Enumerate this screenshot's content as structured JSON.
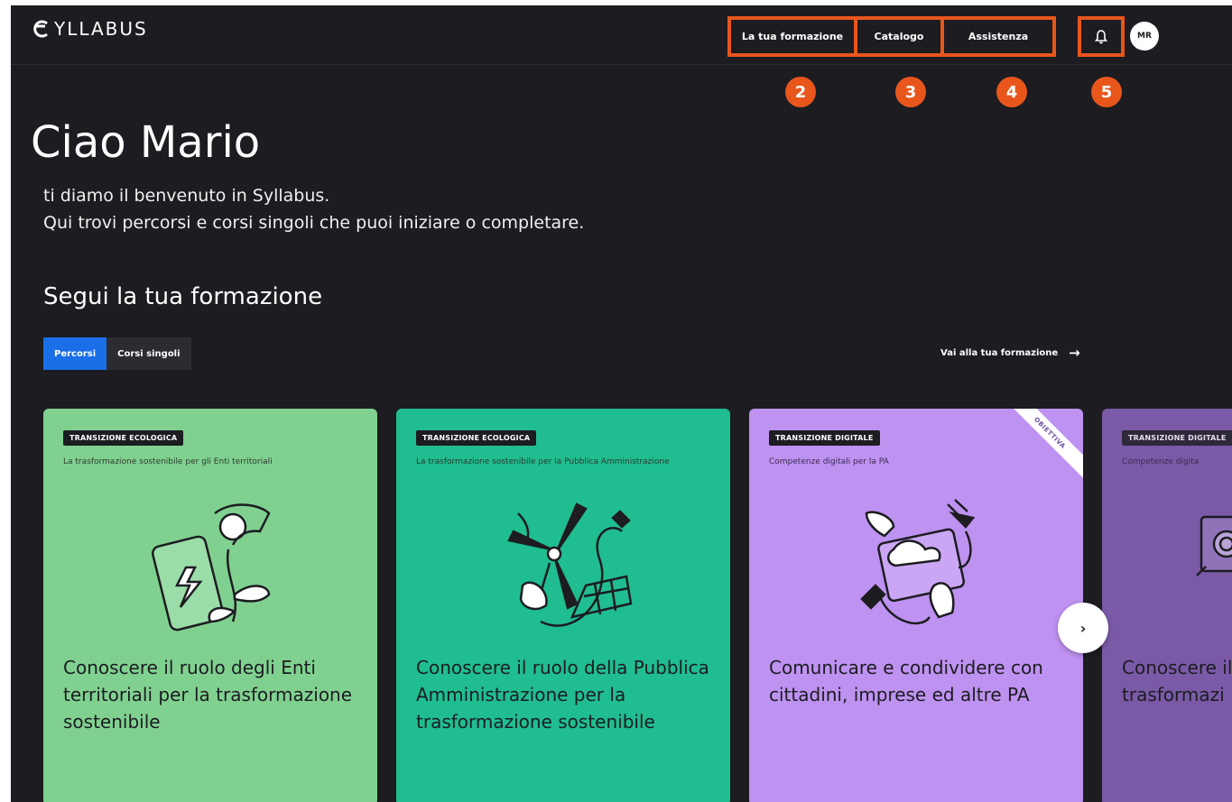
{
  "header": {
    "logo_text": "YLLABUS",
    "nav": {
      "formazione": "La tua formazione",
      "catalogo": "Catalogo",
      "assistenza": "Assistenza"
    },
    "avatar_initials": "MR",
    "annotations": [
      "2",
      "3",
      "4",
      "5"
    ]
  },
  "hero": {
    "greeting": "Ciao Mario",
    "line1": "ti diamo il benvenuto in Syllabus.",
    "line2": "Qui trovi percorsi e corsi singoli che puoi iniziare o completare."
  },
  "section": {
    "title": "Segui la tua formazione",
    "tabs": [
      {
        "label": "Percorsi",
        "active": true
      },
      {
        "label": "Corsi singoli",
        "active": false
      }
    ],
    "link": "Vai alla tua formazione"
  },
  "cards": [
    {
      "tag": "TRANSIZIONE ECOLOGICA",
      "subtitle": "La trasformazione sostenibile per gli Enti territoriali",
      "title": "Conoscere il ruolo degli Enti territoriali per la trasformazione sostenibile",
      "color": "#80d190"
    },
    {
      "tag": "TRANSIZIONE ECOLOGICA",
      "subtitle": "La trasformazione sostenibile per la Pubblica Amministrazione",
      "title": "Conoscere il ruolo della Pubblica Amministrazione per la trasformazione sostenibile",
      "color": "#20bd90"
    },
    {
      "tag": "TRANSIZIONE DIGITALE",
      "subtitle": "Competenze digitali per la PA",
      "title": "Comunicare e condividere con cittadini, imprese ed altre PA",
      "ribbon": "OBIETTIVA",
      "color": "#be92f0"
    },
    {
      "tag": "TRANSIZIONE DIGITALE",
      "subtitle": "Competenze digita",
      "title": "Conoscere il trasformazi",
      "color": "#7a5aa6"
    }
  ],
  "colors": {
    "background": "#1c1c21",
    "accent_annotation": "#e8561c",
    "tab_active": "#1a6fe8"
  }
}
